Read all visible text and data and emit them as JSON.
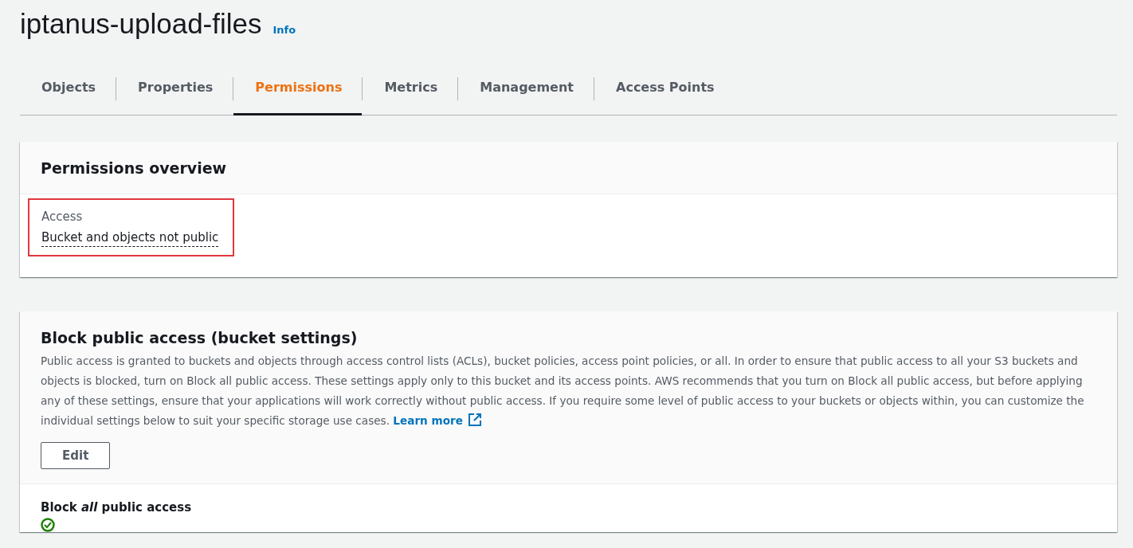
{
  "page_title": "iptanus-upload-files",
  "info_link": "Info",
  "tabs": [
    {
      "label": "Objects",
      "selected": false
    },
    {
      "label": "Properties",
      "selected": false
    },
    {
      "label": "Permissions",
      "selected": true
    },
    {
      "label": "Metrics",
      "selected": false
    },
    {
      "label": "Management",
      "selected": false
    },
    {
      "label": "Access Points",
      "selected": false
    }
  ],
  "permissions_overview": {
    "title": "Permissions overview",
    "access_label": "Access",
    "access_value": "Bucket and objects not public",
    "highlighted": true
  },
  "block_public_access": {
    "title": "Block public access (bucket settings)",
    "description": "Public access is granted to buckets and objects through access control lists (ACLs), bucket policies, access point policies, or all. In order to ensure that public access to all your S3 buckets and objects is blocked, turn on Block all public access. These settings apply only to this bucket and its access points. AWS recommends that you turn on Block all public access, but before applying any of these settings, ensure that your applications will work correctly without public access. If you require some level of public access to your buckets or objects within, you can customize the individual settings below to suit your specific storage use cases.",
    "learn_more": "Learn more",
    "edit_button": "Edit",
    "setting_label": "Block *all* public access",
    "setting_on": true
  }
}
